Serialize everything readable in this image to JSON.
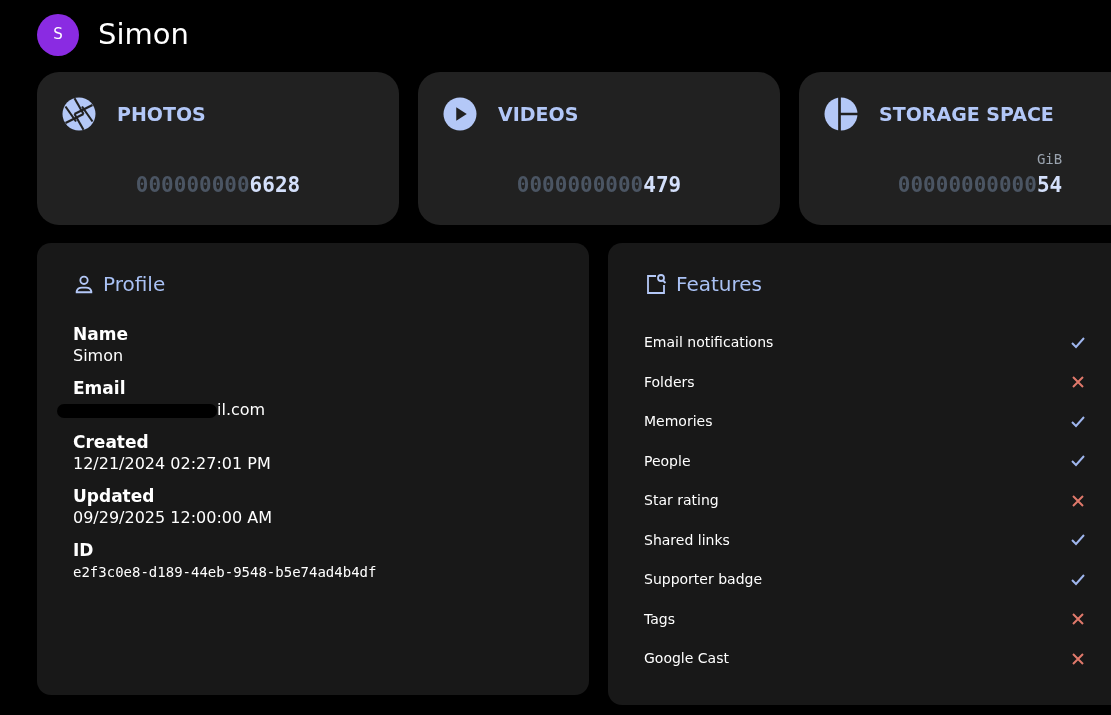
{
  "user": {
    "initial": "S",
    "name": "Simon"
  },
  "stats": [
    {
      "kind": "photos",
      "label": "PHOTOS",
      "zeros": "000000000",
      "value": "6628"
    },
    {
      "kind": "videos",
      "label": "VIDEOS",
      "zeros": "0000000000",
      "value": "479"
    },
    {
      "kind": "storage",
      "label": "STORAGE SPACE",
      "unit": "GiB",
      "zeros": "00000000000",
      "value": "54"
    }
  ],
  "profile": {
    "title": "Profile",
    "fields": [
      {
        "label": "Name",
        "value": "Simon",
        "kind": "text"
      },
      {
        "label": "Email",
        "value": "il.com",
        "kind": "redacted"
      },
      {
        "label": "Created",
        "value": "12/21/2024 02:27:01 PM",
        "kind": "text"
      },
      {
        "label": "Updated",
        "value": "09/29/2025 12:00:00 AM",
        "kind": "text"
      },
      {
        "label": "ID",
        "value": "e2f3c0e8-d189-44eb-9548-b5e74ad4b4df",
        "kind": "mono"
      }
    ]
  },
  "features": {
    "title": "Features",
    "items": [
      {
        "label": "Email notifications",
        "enabled": true
      },
      {
        "label": "Folders",
        "enabled": false
      },
      {
        "label": "Memories",
        "enabled": true
      },
      {
        "label": "People",
        "enabled": true
      },
      {
        "label": "Star rating",
        "enabled": false
      },
      {
        "label": "Shared links",
        "enabled": true
      },
      {
        "label": "Supporter badge",
        "enabled": true
      },
      {
        "label": "Tags",
        "enabled": false
      },
      {
        "label": "Google Cast",
        "enabled": false
      }
    ]
  }
}
